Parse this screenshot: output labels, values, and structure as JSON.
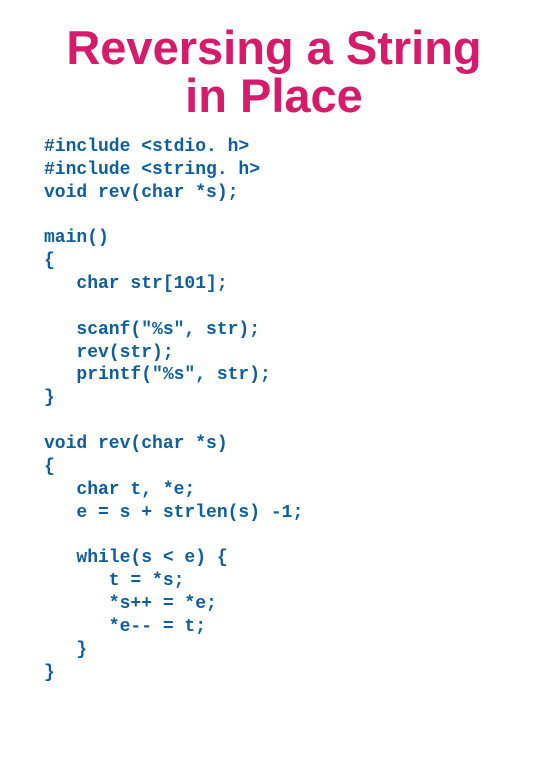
{
  "title": "Reversing a String in Place",
  "code": "#include <stdio. h>\n#include <string. h>\nvoid rev(char *s);\n\nmain()\n{\n   char str[101];\n\n   scanf(\"%s\", str);\n   rev(str);\n   printf(\"%s\", str);\n}\n\nvoid rev(char *s)\n{\n   char t, *e;\n   e = s + strlen(s) -1;\n\n   while(s < e) {\n      t = *s;\n      *s++ = *e;\n      *e-- = t;\n   }\n}"
}
